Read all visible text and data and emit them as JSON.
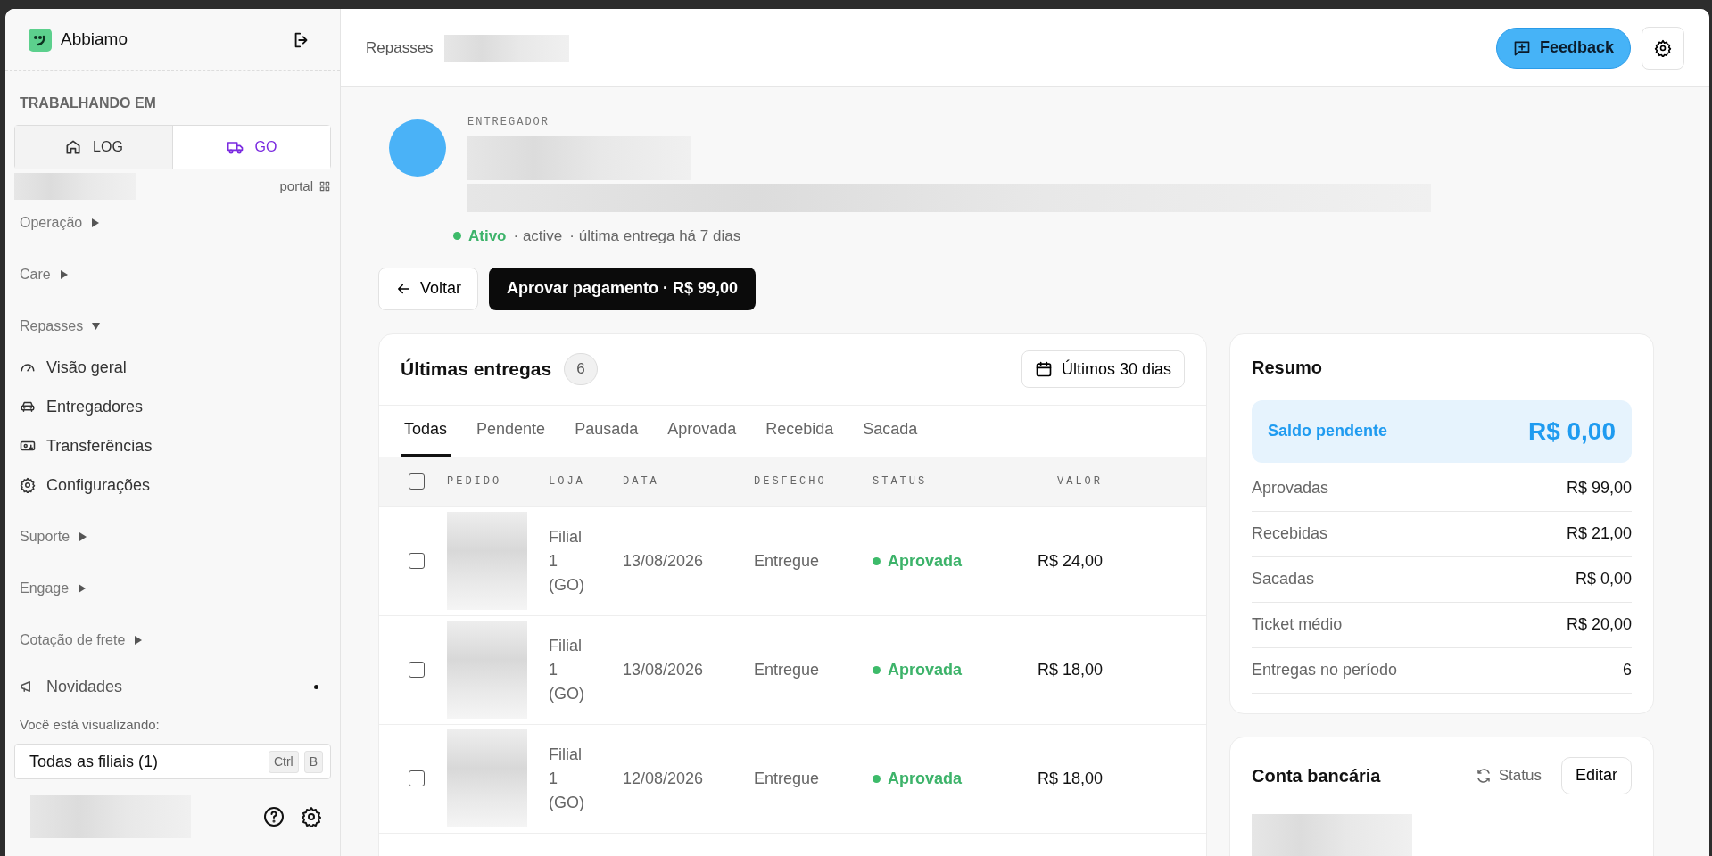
{
  "sidebar": {
    "brand": "Abbiamo",
    "section_label": "TRABALHANDO EM",
    "workspaces": [
      {
        "label": "LOG",
        "kind": "home",
        "selected": false
      },
      {
        "label": "GO",
        "kind": "truck",
        "selected": true
      }
    ],
    "portal_link": "portal",
    "menu": [
      {
        "label": "Operação",
        "expanded": false
      },
      {
        "label": "Care",
        "expanded": false
      },
      {
        "label": "Repasses",
        "expanded": true,
        "children": [
          {
            "label": "Visão geral",
            "kind": "gauge"
          },
          {
            "label": "Entregadores",
            "kind": "car"
          },
          {
            "label": "Transferências",
            "kind": "transfer"
          },
          {
            "label": "Configurações",
            "kind": "gear"
          }
        ]
      },
      {
        "label": "Suporte",
        "expanded": false
      },
      {
        "label": "Engage",
        "expanded": false
      },
      {
        "label": "Cotação de frete",
        "expanded": false
      }
    ],
    "news": {
      "label": "Novidades",
      "unread": true
    },
    "viewing_label": "Você está visualizando:",
    "branch_selector": {
      "value": "Todas as filiais (1)",
      "shortcut": [
        "Ctrl",
        "B"
      ]
    }
  },
  "header": {
    "breadcrumb": "Repasses",
    "feedback_button": "Feedback"
  },
  "driver": {
    "role": "ENTREGADOR",
    "status": "Ativo",
    "state": "· active",
    "last_delivery": "· última entrega há 7 dias"
  },
  "actions": {
    "back": "Voltar",
    "approve": "Aprovar pagamento · R$ 99,00"
  },
  "deliveries": {
    "title": "Últimas entregas",
    "count": "6",
    "period": "Últimos 30 dias",
    "tabs": [
      {
        "label": "Todas",
        "selected": true
      },
      {
        "label": "Pendente",
        "selected": false
      },
      {
        "label": "Pausada",
        "selected": false
      },
      {
        "label": "Aprovada",
        "selected": false
      },
      {
        "label": "Recebida",
        "selected": false
      },
      {
        "label": "Sacada",
        "selected": false
      }
    ],
    "select_all_checked": false,
    "columns": [
      "PEDIDO",
      "LOJA",
      "DATA",
      "DESFECHO",
      "STATUS",
      "VALOR"
    ],
    "rows": [
      {
        "checked": false,
        "store": "Filial 1 (GO)",
        "date": "13/08/2026",
        "outcome": "Entregue",
        "status": "Aprovada",
        "value": "R$ 24,00"
      },
      {
        "checked": false,
        "store": "Filial 1 (GO)",
        "date": "13/08/2026",
        "outcome": "Entregue",
        "status": "Aprovada",
        "value": "R$ 18,00"
      },
      {
        "checked": false,
        "store": "Filial 1 (GO)",
        "date": "12/08/2026",
        "outcome": "Entregue",
        "status": "Aprovada",
        "value": "R$ 18,00"
      }
    ]
  },
  "summary": {
    "title": "Resumo",
    "pending_label": "Saldo pendente",
    "pending_value": "R$ 0,00",
    "rows": [
      {
        "label": "Aprovadas",
        "value": "R$ 99,00"
      },
      {
        "label": "Recebidas",
        "value": "R$ 21,00"
      },
      {
        "label": "Sacadas",
        "value": "R$ 0,00"
      },
      {
        "label": "Ticket médio",
        "value": "R$ 20,00"
      },
      {
        "label": "Entregas no período",
        "value": "6"
      }
    ]
  },
  "bank": {
    "title": "Conta bancária",
    "status": "Status",
    "edit": "Editar"
  }
}
